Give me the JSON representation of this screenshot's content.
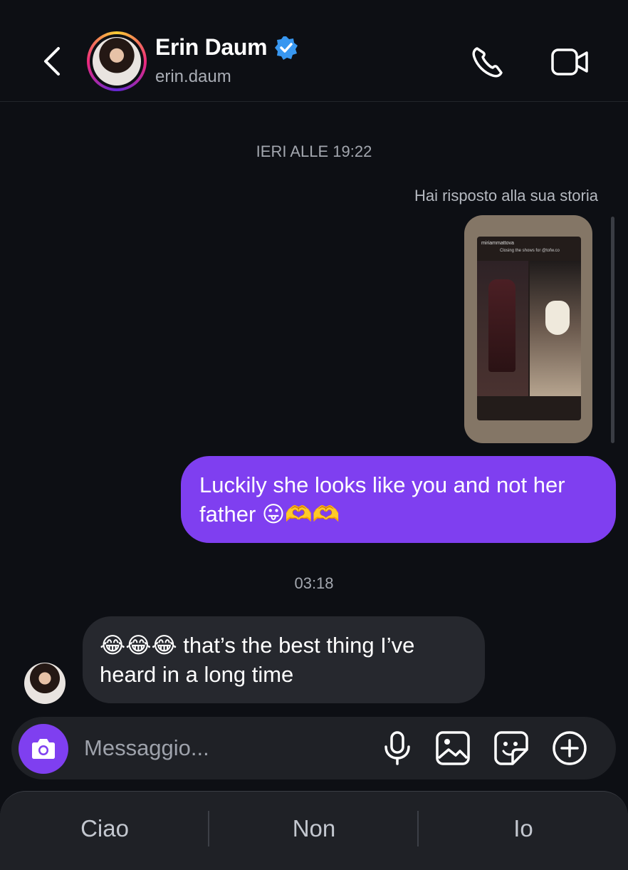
{
  "header": {
    "name": "Erin Daum",
    "username": "erin.daum",
    "icons": [
      "back-chevron-icon",
      "verified-badge-icon",
      "phone-icon",
      "video-camera-icon"
    ]
  },
  "chat": {
    "timestamp_1": "IERI ALLE 19:22",
    "reply_label": "Hai risposto alla sua storia",
    "story_preview": {
      "account": "miriammattova",
      "caption": "Closing the shows for @tofw.co"
    },
    "outgoing_message": "Luckily she looks like you and not her father 😛🫶🫶",
    "timestamp_2": "03:18",
    "incoming_message": "😂😂😂 that’s the best thing I’ve heard in a long time"
  },
  "composer": {
    "placeholder": "Messaggio...",
    "icons": [
      "camera-icon",
      "microphone-icon",
      "gallery-icon",
      "sticker-icon",
      "plus-icon"
    ]
  },
  "suggestions": [
    "Ciao",
    "Non",
    "Io"
  ],
  "colors": {
    "background": "#0d0f14",
    "accent": "#7f3ff0",
    "incoming_bubble": "#26282e",
    "verified": "#3897f0"
  }
}
